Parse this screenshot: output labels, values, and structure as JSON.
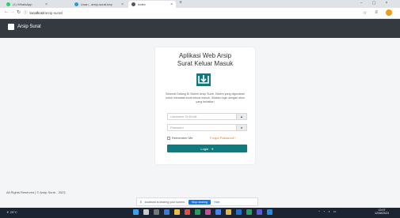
{
  "browser": {
    "tabs": [
      {
        "label": "(1) WhatsApp",
        "color": "#25d366"
      },
      {
        "label": "Lisan - arsip-surat-kep",
        "color": "#2b9bdc"
      },
      {
        "label": "Index",
        "color": "#444444"
      }
    ],
    "new_tab": "+",
    "url_scheme": "ⓘ",
    "url_host": "localhost",
    "url_path": "/arsip-surat/"
  },
  "app": {
    "brand": "Arsip Surat",
    "title_line1": "Aplikasi Web Arsip",
    "title_line2": "Surat Keluar Masuk",
    "description": "Selamat Datang Di Sistem Arsip Surat. Sistem yang digunakan untuk mencatat surat keluar masuk. Silakan login dengan akun yang terdaftar!",
    "username_placeholder": "Username Or Email",
    "password_placeholder": "Password",
    "remember_label": "Remember Me",
    "forgot_label": "Forgot Password?",
    "login_label": "Login",
    "footer": "All Rights Reserved | © Arsip Surat - 2023"
  },
  "sharing": {
    "message": "localhost is sharing your screen.",
    "stop_label": "Stop sharing",
    "hide_label": "Hide"
  },
  "taskbar": {
    "weather": "29°C",
    "time": "13:07",
    "date": "12/06/2023"
  },
  "colors": {
    "accent": "#117a7f",
    "navbar": "#343a40",
    "forgot": "#e67e22"
  }
}
